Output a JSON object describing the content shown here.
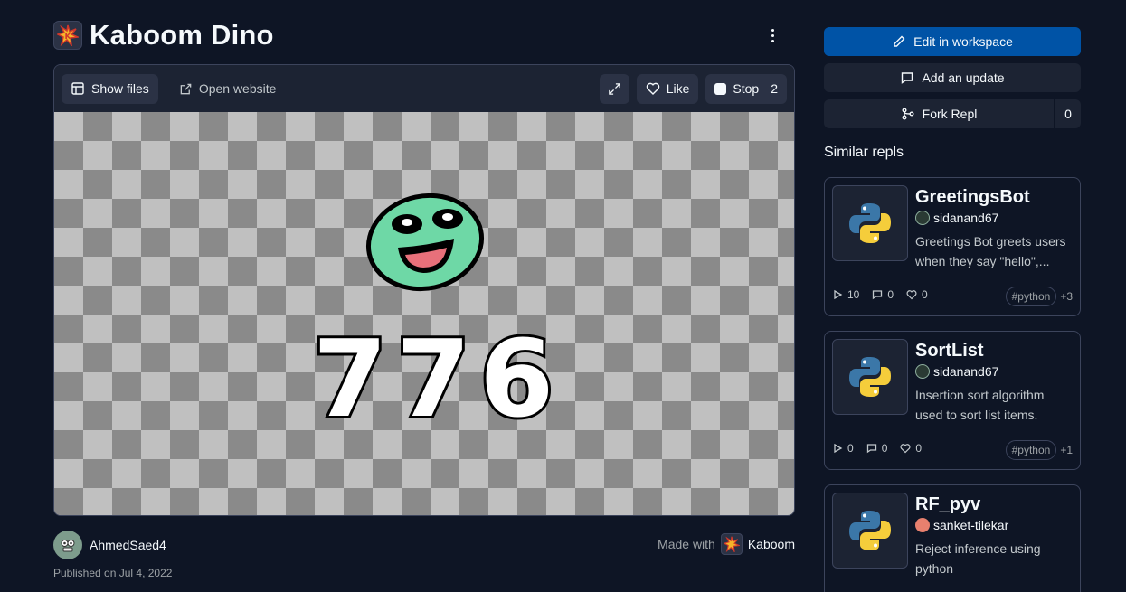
{
  "repl": {
    "title": "Kaboom Dino",
    "author": "AhmedSaed4",
    "published": "Published on Jul 4, 2022",
    "made_with_label": "Made with",
    "made_with_brand": "Kaboom"
  },
  "toolbar": {
    "show_files": "Show files",
    "open_website": "Open website",
    "like": "Like",
    "stop": "Stop",
    "stop_count": "2"
  },
  "game": {
    "score": "776"
  },
  "sidebar": {
    "edit": "Edit in workspace",
    "update": "Add an update",
    "fork": "Fork Repl",
    "fork_count": "0",
    "similar_heading": "Similar repls"
  },
  "similar": [
    {
      "name": "GreetingsBot",
      "user": "sidanand67",
      "desc": "Greetings Bot greets users when they say \"hello\",...",
      "runs": "10",
      "comments": "0",
      "likes": "0",
      "tag": "#python",
      "more": "+3"
    },
    {
      "name": "SortList",
      "user": "sidanand67",
      "desc": "Insertion sort algorithm used to sort list items.",
      "runs": "0",
      "comments": "0",
      "likes": "0",
      "tag": "#python",
      "more": "+1"
    },
    {
      "name": "RF_pyv",
      "user": "sanket-tilekar",
      "desc": "Reject inference using python",
      "runs": "",
      "comments": "",
      "likes": "",
      "tag": "",
      "more": ""
    }
  ],
  "colors": {
    "background": "#0e1525",
    "primary": "#0053a6",
    "surface": "#1c2333"
  }
}
